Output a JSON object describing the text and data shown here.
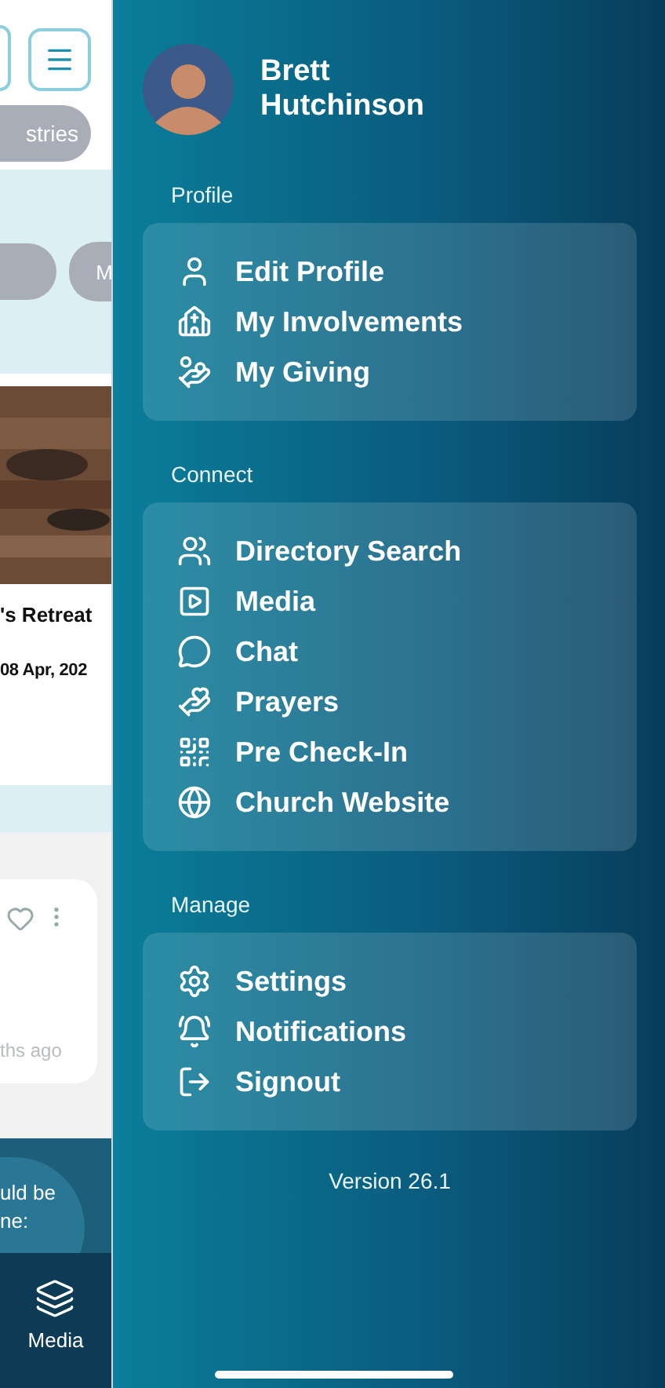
{
  "background_screen": {
    "filter_chip": "stries",
    "circle_label": "M",
    "event_title": "'s Retreat",
    "event_date": "08 Apr, 202",
    "post_time": "ths ago",
    "banner_lines": [
      "uld be",
      "ne:"
    ],
    "tab_label": "Media"
  },
  "drawer": {
    "user_name": "Brett Hutchinson",
    "sections": [
      {
        "title": "Profile",
        "items": [
          "Edit Profile",
          "My Involvements",
          "My Giving"
        ]
      },
      {
        "title": "Connect",
        "items": [
          "Directory Search",
          "Media",
          "Chat",
          "Prayers",
          "Pre Check-In",
          "Church Website"
        ]
      },
      {
        "title": "Manage",
        "items": [
          "Settings",
          "Notifications",
          "Signout"
        ]
      }
    ],
    "version": "Version 26.1"
  }
}
